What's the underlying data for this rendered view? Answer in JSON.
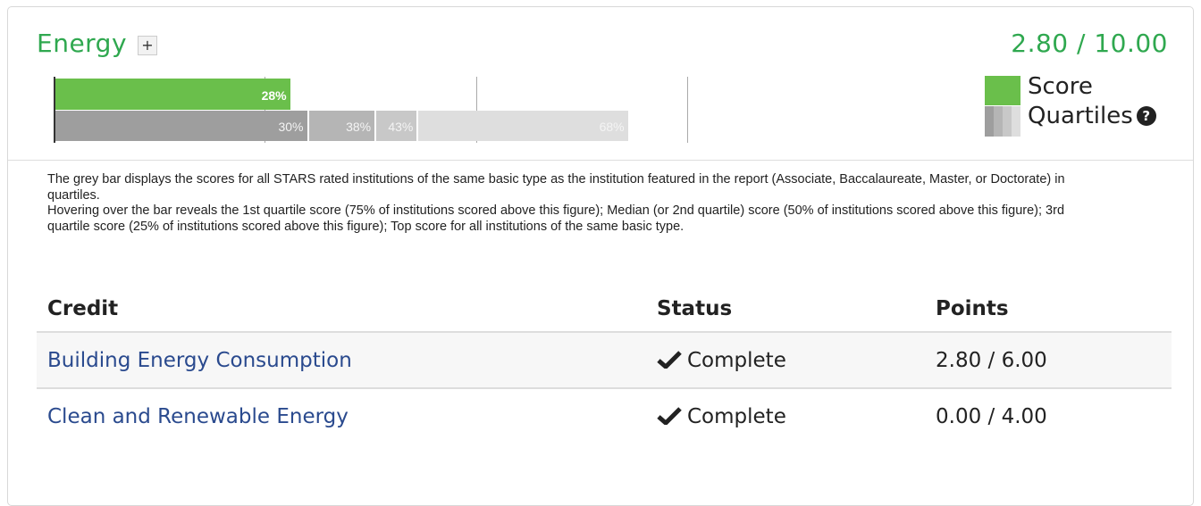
{
  "section": {
    "title": "Energy",
    "expand_label": "+",
    "total_score": "2.80 / 10.00"
  },
  "chart_data": {
    "type": "bar",
    "title": "",
    "score": {
      "name": "Score",
      "value": 28,
      "label": "28%",
      "color": "#6abf4b"
    },
    "quartiles": [
      {
        "value": 30,
        "label": "30%"
      },
      {
        "value": 38,
        "label": "38%"
      },
      {
        "value": 43,
        "label": "43%"
      },
      {
        "value": 68,
        "label": "68%"
      }
    ],
    "xlim": [
      0,
      100
    ],
    "gridlines": [
      0,
      25,
      50,
      75,
      100
    ]
  },
  "legend": {
    "score_label": "Score",
    "quartiles_label": "Quartiles",
    "help_icon": "question-circle-icon"
  },
  "description": {
    "line1": "The grey bar displays the scores for all STARS rated institutions of the same basic type as the institution featured in the report (Associate, Baccalaureate, Master, or Doctorate) in quartiles.",
    "line2": "Hovering over the bar reveals the 1st quartile score (75% of institutions scored above this figure); Median (or 2nd quartile) score (50% of institutions scored above this figure); 3rd quartile score (25% of institutions scored above this figure); Top score for all institutions of the same basic type."
  },
  "table": {
    "headers": {
      "credit": "Credit",
      "status": "Status",
      "points": "Points"
    },
    "rows": [
      {
        "credit": "Building Energy Consumption",
        "status": "Complete",
        "points": "2.80 / 6.00"
      },
      {
        "credit": "Clean and Renewable Energy",
        "status": "Complete",
        "points": "0.00 / 4.00"
      }
    ]
  }
}
